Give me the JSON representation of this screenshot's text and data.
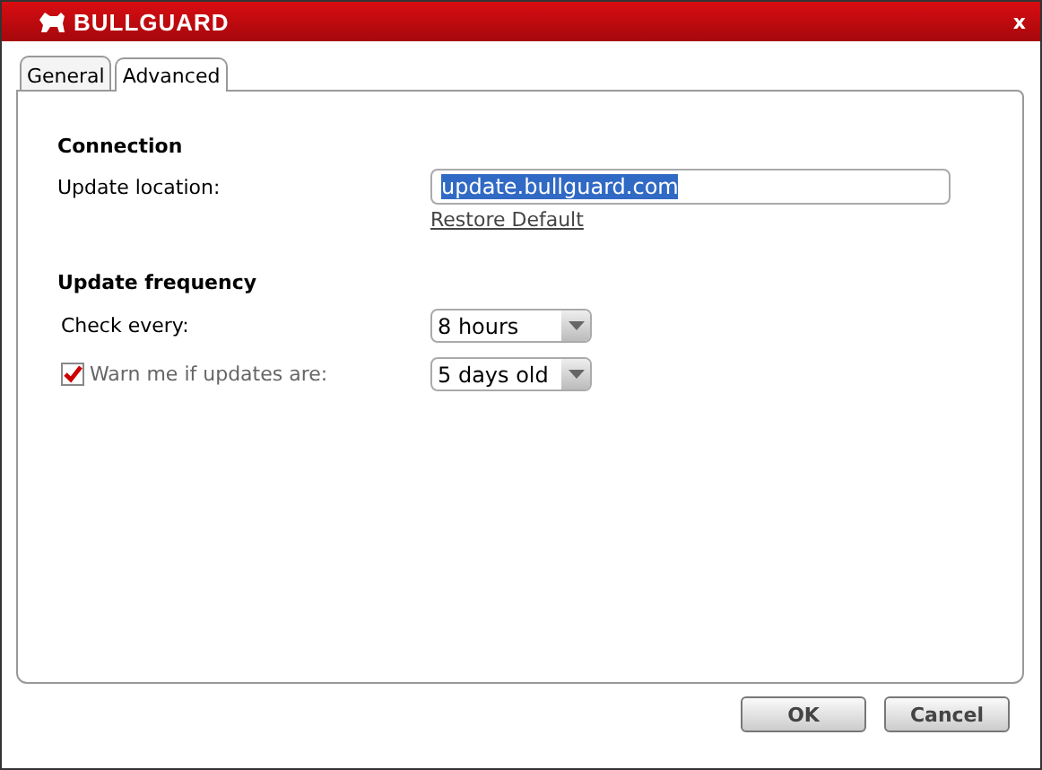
{
  "window": {
    "title": "BULLGUARD",
    "close": "x"
  },
  "tabs": [
    {
      "label": "General",
      "selected": false
    },
    {
      "label": "Advanced",
      "selected": true
    }
  ],
  "connection": {
    "heading": "Connection",
    "label": "Update location:",
    "value": "update.bullguard.com",
    "restore_link": "Restore Default"
  },
  "frequency": {
    "heading": "Update frequency",
    "rows": [
      {
        "kind": "plain",
        "label": "Check every:",
        "value": "8 hours"
      },
      {
        "kind": "checkbox",
        "label": "Warn me if updates are:",
        "checked": true,
        "value": "5 days old"
      }
    ]
  },
  "buttons": [
    "OK",
    "Cancel"
  ]
}
